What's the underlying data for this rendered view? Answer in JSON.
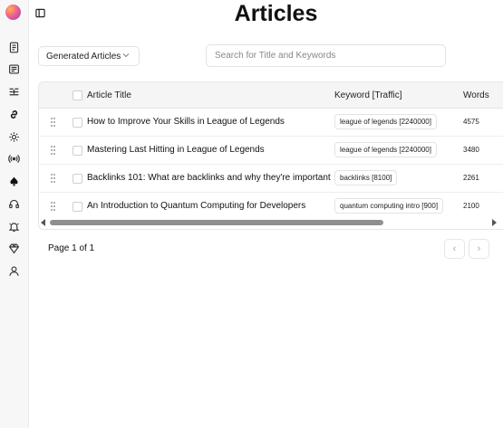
{
  "header": {
    "title": "Articles"
  },
  "filters": {
    "article_type": "Generated Articles",
    "search_placeholder": "Search for Title and Keywords"
  },
  "table": {
    "columns": {
      "title": "Article Title",
      "keyword": "Keyword [Traffic]",
      "words": "Words"
    },
    "rows": [
      {
        "title": "How to Improve Your Skills in League of Legends",
        "keyword": "league of legends [2240000]",
        "words": "4575"
      },
      {
        "title": "Mastering Last Hitting in League of Legends",
        "keyword": "league of legends [2240000]",
        "words": "3480"
      },
      {
        "title": "Backlinks 101: What are backlinks and why they're important",
        "keyword": "backlinks [8100]",
        "words": "2261"
      },
      {
        "title": "An Introduction to Quantum Computing for Developers",
        "keyword": "quantum computing intro [900]",
        "words": "2100"
      }
    ]
  },
  "pagination": {
    "label": "Page 1 of 1",
    "prev": "‹",
    "next": "›"
  },
  "sidebar": {
    "icons": [
      "document-icon",
      "newspaper-icon",
      "sparkle-grid-icon",
      "link-icon",
      "gear-cog-icon",
      "radio-icon",
      "spade-icon",
      "headset-icon",
      "bell-icon",
      "gem-icon",
      "user-icon"
    ]
  }
}
